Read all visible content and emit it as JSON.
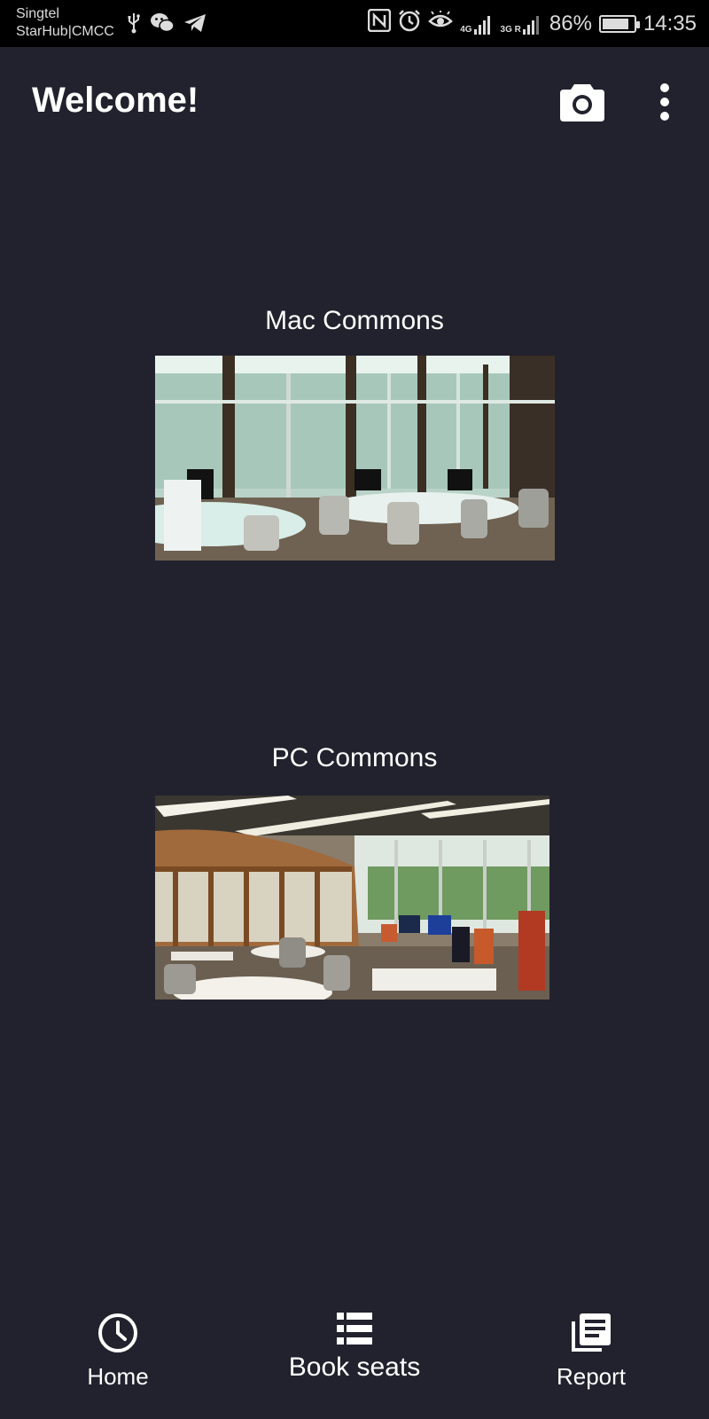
{
  "status_bar": {
    "carrier_line1": "Singtel",
    "carrier_line2": "StarHub|CMCC",
    "network_1": "4G",
    "network_2": "3G R",
    "battery": "86%",
    "battery_level": 0.86,
    "time": "14:35"
  },
  "app_bar": {
    "title": "Welcome!",
    "camera_icon": "camera-icon",
    "more_icon": "more-vert-icon"
  },
  "locations": [
    {
      "label": "Mac Commons",
      "image_alt": "Mac Commons photo"
    },
    {
      "label": "PC Commons",
      "image_alt": "PC Commons photo"
    }
  ],
  "bottom_nav": {
    "items": [
      {
        "label": "Home",
        "icon": "clock-icon"
      },
      {
        "label": "Book seats",
        "icon": "list-icon"
      },
      {
        "label": "Report",
        "icon": "report-icon"
      }
    ]
  },
  "colors": {
    "background": "#22222e",
    "status_bar": "#000000",
    "text": "#ffffff"
  }
}
